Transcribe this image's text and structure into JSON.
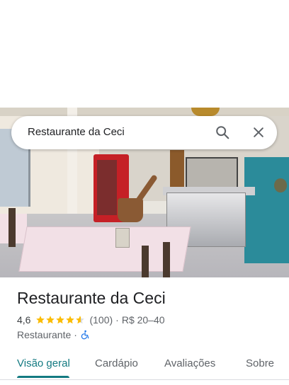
{
  "search": {
    "query": "Restaurante da Ceci"
  },
  "place": {
    "name": "Restaurante da Ceci",
    "rating": "4,6",
    "review_count": "(100)",
    "separator": "·",
    "price_range": "R$ 20–40",
    "category": "Restaurante",
    "category_separator": "·",
    "stars_filled": 4.6
  },
  "tabs": [
    {
      "label": "Visão geral",
      "active": true
    },
    {
      "label": "Cardápio",
      "active": false
    },
    {
      "label": "Avaliações",
      "active": false
    },
    {
      "label": "Sobre",
      "active": false
    }
  ],
  "colors": {
    "accent": "#137a81",
    "star": "#fbbc04",
    "accessible_icon": "#1a73e8"
  },
  "icons": [
    "search-icon",
    "close-icon",
    "star-icon",
    "wheelchair-icon"
  ]
}
